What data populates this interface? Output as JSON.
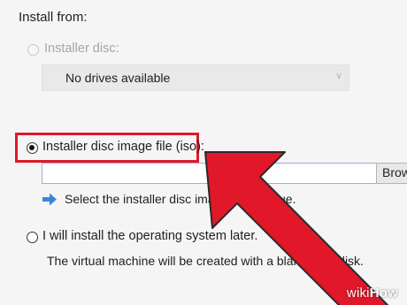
{
  "install_from": {
    "section_title": "Install from:",
    "installer_disc": {
      "label": "Installer disc:",
      "selected": false,
      "enabled": false,
      "drive_dropdown_value": "No drives available"
    },
    "iso_option": {
      "label": "Installer disc image file (iso):",
      "selected": true,
      "path_value": "",
      "browse_label": "Browse...",
      "hint": "Select the installer disc image to continue."
    },
    "later_option": {
      "label": "I will install the operating system later.",
      "selected": false,
      "description": "The virtual machine will be created with a blank hard disk."
    }
  },
  "annotation": {
    "arrow_color": "#e0182a",
    "highlight_color": "#e0182a"
  },
  "watermark": {
    "brand_a": "wiki",
    "brand_b": "How"
  },
  "icons": [
    "info-arrow-icon",
    "chevron-down-icon",
    "pointer-arrow-icon"
  ]
}
